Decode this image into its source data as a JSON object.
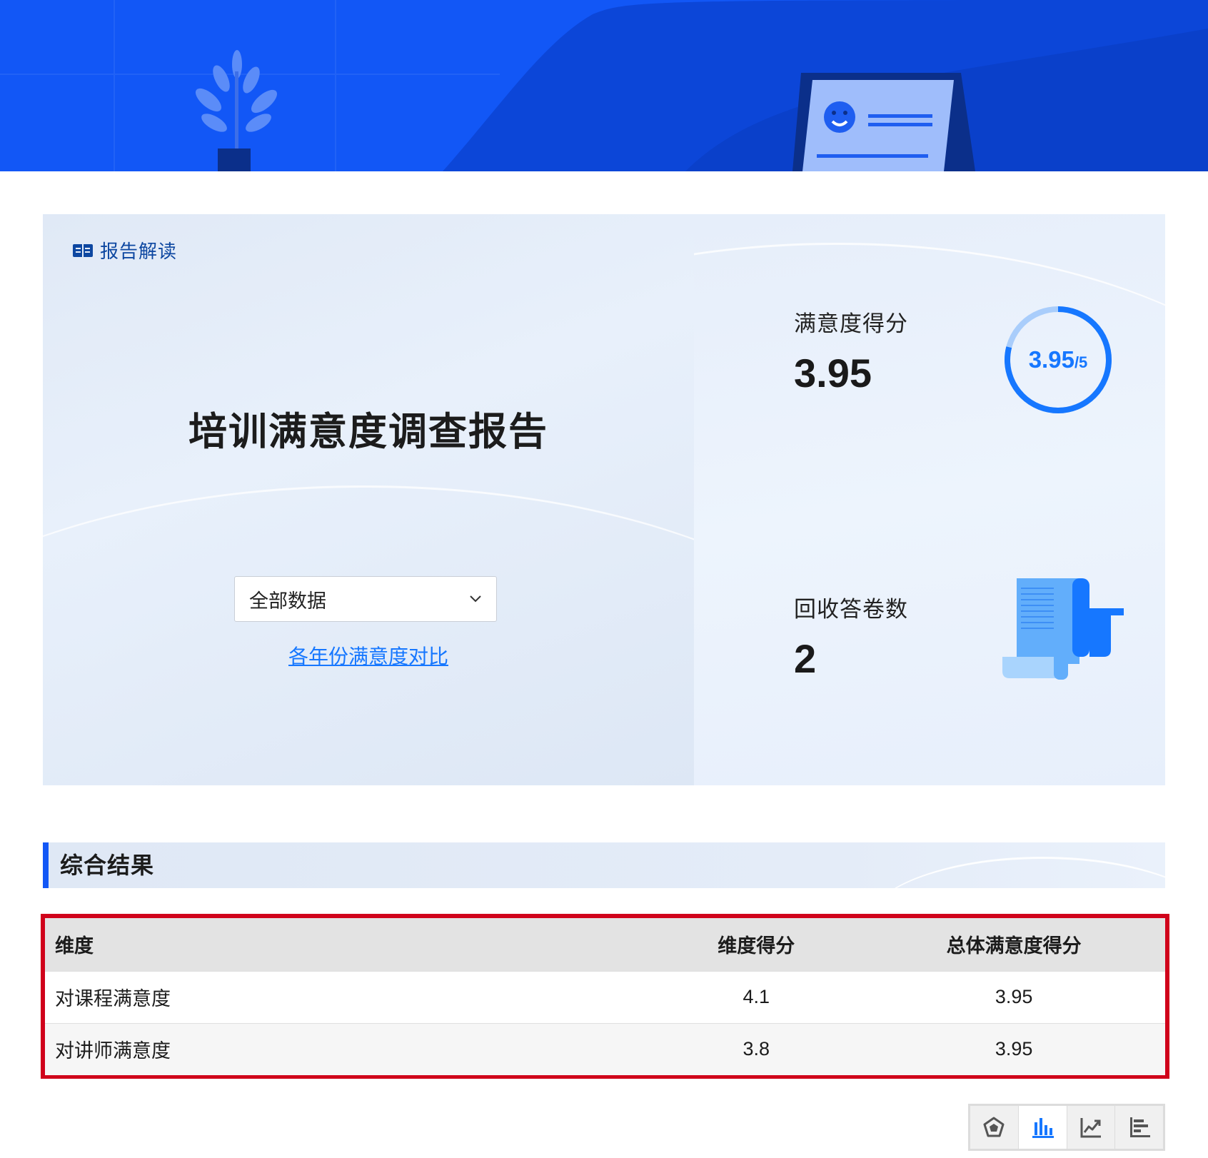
{
  "header": {
    "report_tag": "报告解读",
    "title": "培训满意度调查报告"
  },
  "filter": {
    "selected": "全部数据",
    "compare_link": "各年份满意度对比"
  },
  "stats": {
    "satisfaction": {
      "label": "满意度得分",
      "value": "3.95",
      "ring_value": "3.95",
      "ring_max": "/5",
      "fraction": 0.79
    },
    "responses": {
      "label": "回收答卷数",
      "value": "2"
    }
  },
  "section": {
    "title": "综合结果"
  },
  "table": {
    "headers": [
      "维度",
      "维度得分",
      "总体满意度得分"
    ],
    "rows": [
      [
        "对课程满意度",
        "4.1",
        "3.95"
      ],
      [
        "对讲师满意度",
        "3.8",
        "3.95"
      ]
    ]
  },
  "chart_toolbar": {
    "buttons": [
      "radar-chart-icon",
      "bar-chart-icon",
      "line-chart-icon",
      "horizontal-bar-chart-icon"
    ],
    "active": "bar-chart-icon"
  },
  "colors": {
    "primary": "#1257f6",
    "accent": "#1677ff",
    "highlight_border": "#d0021b"
  }
}
